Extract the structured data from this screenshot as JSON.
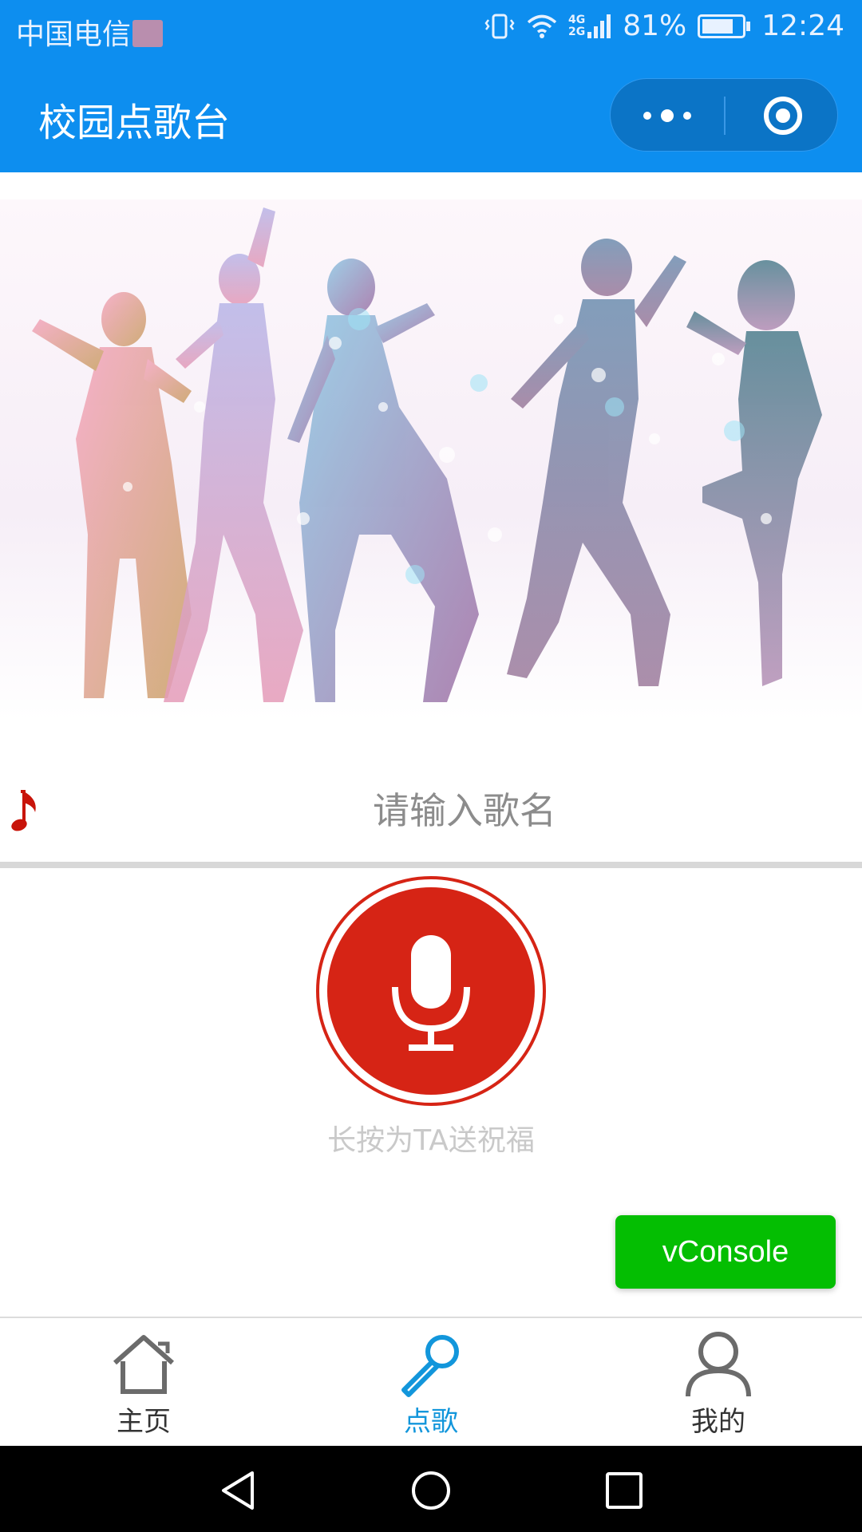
{
  "status_bar": {
    "carrier": "中国电信",
    "net_top": "4G",
    "net_bottom": "2G",
    "battery_percent": "81%",
    "battery_level": 0.81,
    "time": "12:24"
  },
  "nav": {
    "title": "校园点歌台"
  },
  "search": {
    "placeholder": "请输入歌名",
    "value": ""
  },
  "mic": {
    "hint": "长按为TA送祝福"
  },
  "vconsole": {
    "label": "vConsole"
  },
  "tabs": [
    {
      "label": "主页",
      "icon": "home-icon",
      "active": false
    },
    {
      "label": "点歌",
      "icon": "microphone-icon",
      "active": true
    },
    {
      "label": "我的",
      "icon": "user-icon",
      "active": false
    }
  ],
  "colors": {
    "brand_blue": "#0d8eef",
    "mic_red": "#d62415",
    "tab_active": "#1296db",
    "vconsole_green": "#04be02"
  }
}
